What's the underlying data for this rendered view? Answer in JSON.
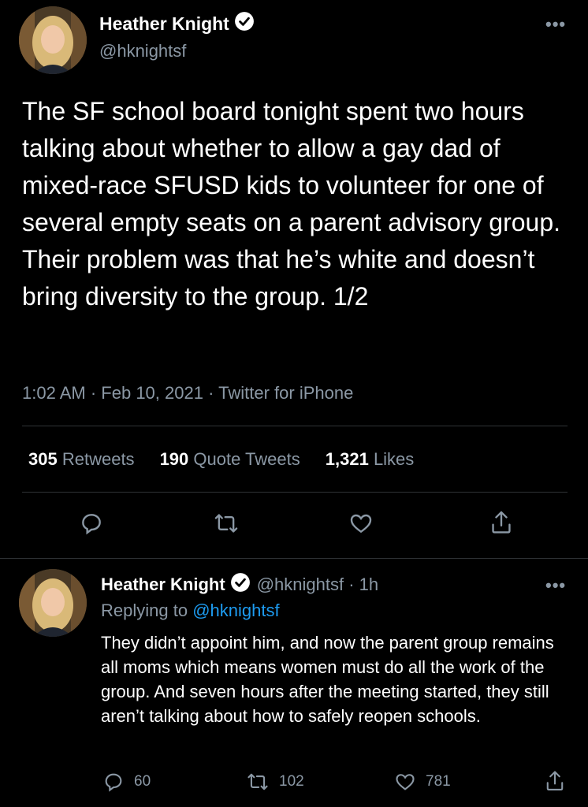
{
  "main_tweet": {
    "author_name": "Heather Knight",
    "handle": "@hknightsf",
    "more": "•••",
    "text": "The SF school board tonight spent two hours talking about whether to allow a gay dad of mixed-race SFUSD kids to volunteer for one of several empty seats on a parent advisory group. Their problem was that he’s white and doesn’t bring diversity to the group. 1/2",
    "time": "1:02 AM",
    "date": "Feb 10, 2021",
    "source": "Twitter for iPhone",
    "retweets_count": "305",
    "retweets_label": "Retweets",
    "quote_count": "190",
    "quote_label": "Quote Tweets",
    "likes_count": "1,321",
    "likes_label": "Likes"
  },
  "reply_tweet": {
    "author_name": "Heather Knight",
    "handle": "@hknightsf",
    "time_ago": "1h",
    "more": "•••",
    "replying_to_label": "Replying to",
    "replying_to_handle": "@hknightsf",
    "text": "They didn’t appoint him, and now the parent group remains all moms which means women must do all the work of the group. And seven hours after the meeting started, they still aren’t talking about how to safely reopen schools.",
    "reply_count": "60",
    "retweet_count": "102",
    "like_count": "781"
  },
  "colors": {
    "background": "#000000",
    "text": "#ffffff",
    "secondary": "#8b98a5",
    "link": "#1d9bf0",
    "divider": "#2f3336"
  },
  "icons": [
    "verified-badge-icon",
    "more-icon",
    "reply-icon",
    "retweet-icon",
    "like-icon",
    "share-icon"
  ]
}
